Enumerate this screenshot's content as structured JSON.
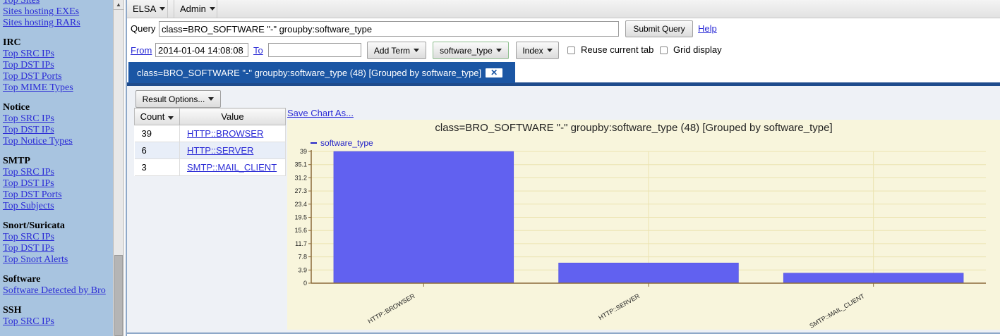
{
  "sidebar": {
    "sections": [
      {
        "heading": "",
        "links": [
          "Top Sites",
          "Sites hosting EXEs",
          "Sites hosting RARs"
        ]
      },
      {
        "heading": "IRC",
        "links": [
          "Top SRC IPs",
          "Top DST IPs",
          "Top DST Ports",
          "Top MIME Types"
        ]
      },
      {
        "heading": "Notice",
        "links": [
          "Top SRC IPs",
          "Top DST IPs",
          "Top Notice Types"
        ]
      },
      {
        "heading": "SMTP",
        "links": [
          "Top SRC IPs",
          "Top DST IPs",
          "Top DST Ports",
          "Top Subjects"
        ]
      },
      {
        "heading": "Snort/Suricata",
        "links": [
          "Top SRC IPs",
          "Top DST IPs",
          "Top Snort Alerts"
        ]
      },
      {
        "heading": "Software",
        "links": [
          "Software Detected by Bro"
        ]
      },
      {
        "heading": "SSH",
        "links": [
          "Top SRC IPs"
        ]
      }
    ]
  },
  "menubar": {
    "elsa": "ELSA",
    "admin": "Admin"
  },
  "query": {
    "label": "Query",
    "value": "class=BRO_SOFTWARE \"-\" groupby:software_type",
    "submit": "Submit Query",
    "help": "Help"
  },
  "filters": {
    "from_label": "From",
    "from_value": "2014-01-04 14:08:08",
    "to_label": "To",
    "to_value": "",
    "add_term": "Add Term",
    "groupby": "software_type",
    "index": "Index",
    "reuse_tab": "Reuse current tab",
    "grid_display": "Grid display"
  },
  "tab": {
    "label": "class=BRO_SOFTWARE \"-\" groupby:software_type (48) [Grouped by software_type]",
    "close": "✕"
  },
  "results": {
    "options_label": "Result Options...",
    "columns": [
      "Count",
      "Value"
    ],
    "rows": [
      {
        "count": "39",
        "value": "HTTP::BROWSER"
      },
      {
        "count": "6",
        "value": "HTTP::SERVER"
      },
      {
        "count": "3",
        "value": "SMTP::MAIL_CLIENT"
      }
    ],
    "save_chart": "Save Chart As..."
  },
  "colors": {
    "bar": "#6161f0",
    "legend": "#2323c8",
    "tab": "#1b56a4"
  },
  "chart_data": {
    "type": "bar",
    "title": "class=BRO_SOFTWARE \"-\" groupby:software_type (48) [Grouped by software_type]",
    "categories": [
      "HTTP::BROWSER",
      "HTTP::SERVER",
      "SMTP::MAIL_CLIENT"
    ],
    "series": [
      {
        "name": "software_type",
        "values": [
          39,
          6,
          3
        ]
      }
    ],
    "yticks": [
      "0",
      "3.9",
      "7.8",
      "11.7",
      "15.6",
      "19.5",
      "23.4",
      "27.3",
      "31.2",
      "35.1",
      "39"
    ],
    "ylim": [
      0,
      39
    ],
    "legend": "top-left",
    "grid": true
  }
}
